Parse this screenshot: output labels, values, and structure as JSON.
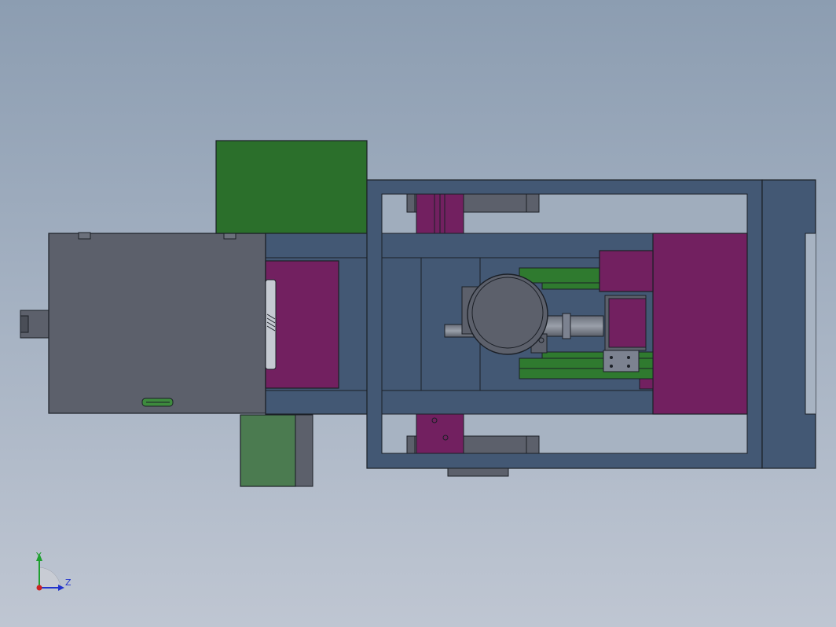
{
  "viewport": {
    "background_top": "#8c9db1",
    "background_bottom": "#bfc6d2"
  },
  "colors": {
    "frame_blue": "#435874",
    "frame_edge": "#20293a",
    "motor_gray": "#5c606b",
    "part_purple": "#722060",
    "part_green": "#2b6f2b",
    "box_green": "#4b7b50",
    "rail_green": "#2f7a2f",
    "dark_gray": "#4a4e57",
    "light_gray": "#7c8290",
    "axis_y": "#1fa02f",
    "axis_z": "#2233cc",
    "axis_origin": "#cc2222"
  },
  "triad": {
    "y_label": "Y",
    "z_label": "Z",
    "icon": "coordinate-triad-icon"
  }
}
